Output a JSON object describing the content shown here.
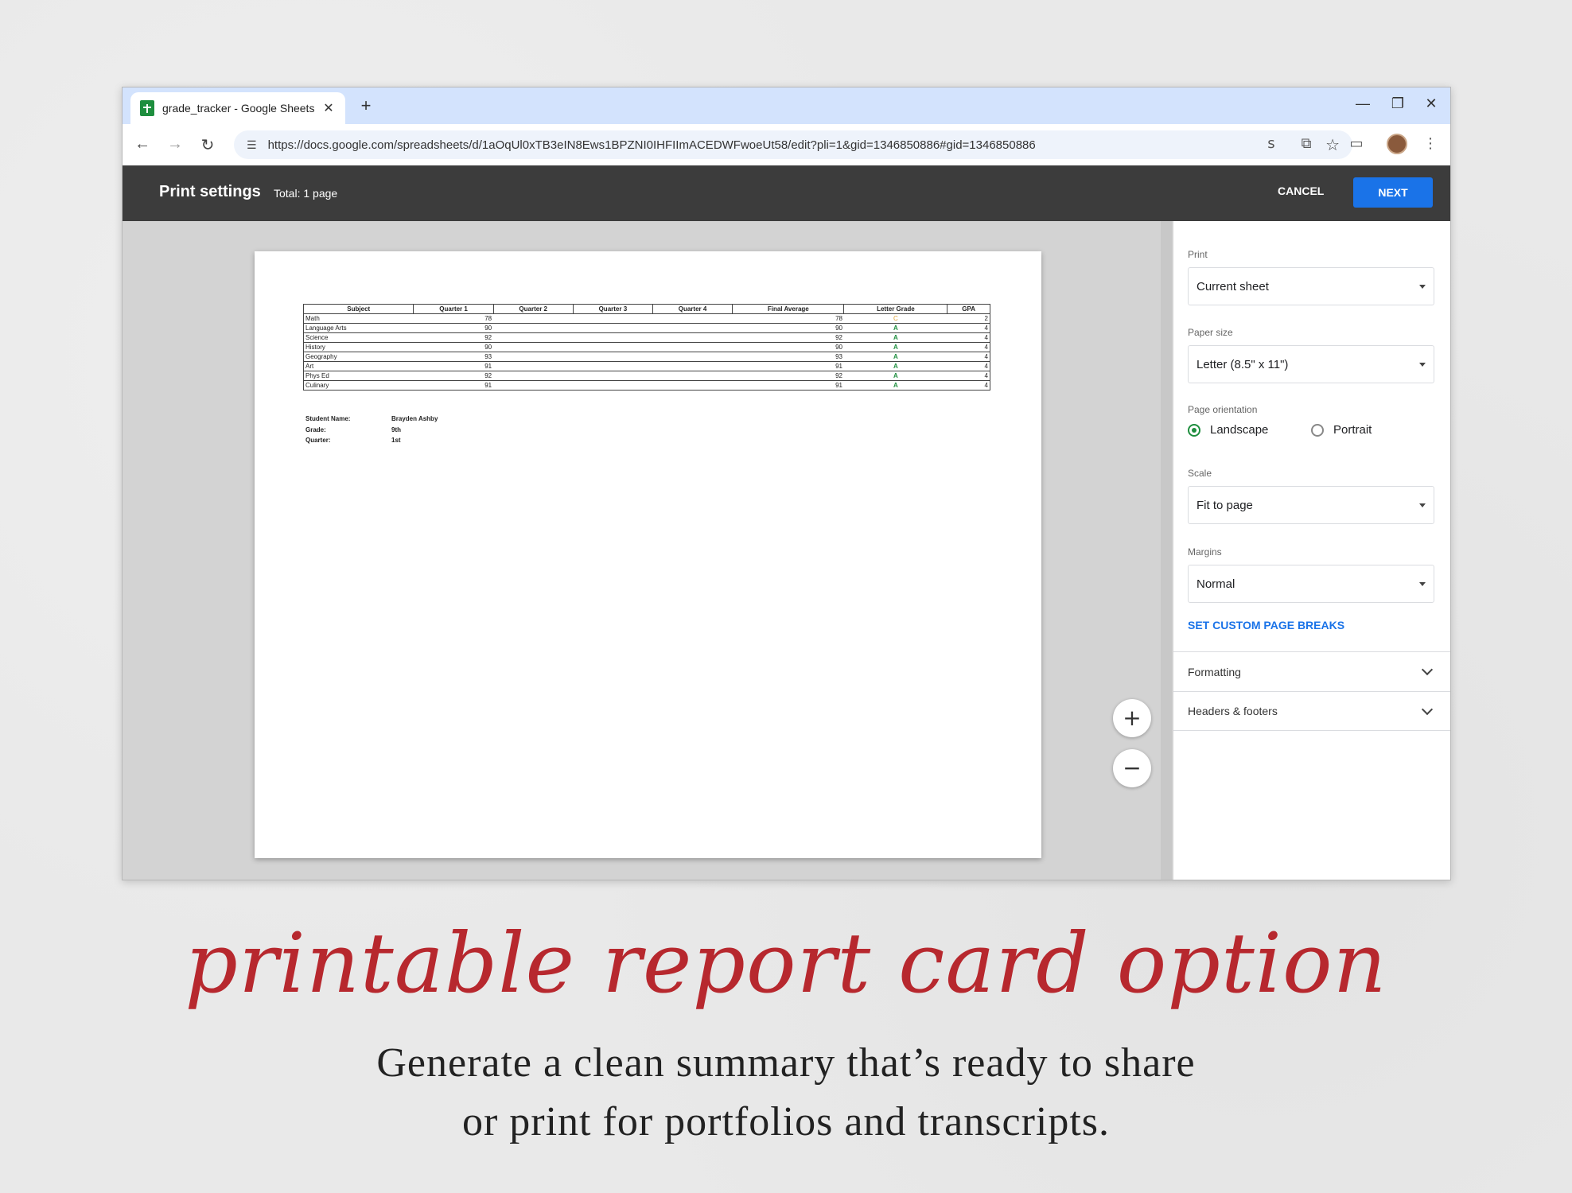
{
  "browser": {
    "tab_title": "grade_tracker - Google Sheets",
    "tab_close": "✕",
    "new_tab": "+",
    "url": "https://docs.google.com/spreadsheets/d/1aOqUl0xTB3eIN8Ews1BPZNI0IHFIImACEDWFwoeUt58/edit?pli=1&gid=1346850886#gid=1346850886",
    "window_controls": [
      "—",
      "❐",
      "✕"
    ],
    "nav": {
      "back": "←",
      "forward": "→",
      "reload": "↻"
    }
  },
  "print_header": {
    "title": "Print settings",
    "total": "Total: 1 page",
    "cancel": "CANCEL",
    "next": "NEXT"
  },
  "report": {
    "columns": [
      "Subject",
      "Quarter 1",
      "Quarter 2",
      "Quarter 3",
      "Quarter 4",
      "Final Average",
      "Letter Grade",
      "GPA"
    ],
    "rows": [
      [
        "Math",
        "78",
        "",
        "",
        "",
        "78",
        "C",
        "2"
      ],
      [
        "Language Arts",
        "90",
        "",
        "",
        "",
        "90",
        "A",
        "4"
      ],
      [
        "Science",
        "92",
        "",
        "",
        "",
        "92",
        "A",
        "4"
      ],
      [
        "History",
        "90",
        "",
        "",
        "",
        "90",
        "A",
        "4"
      ],
      [
        "Geography",
        "93",
        "",
        "",
        "",
        "93",
        "A",
        "4"
      ],
      [
        "Art",
        "91",
        "",
        "",
        "",
        "91",
        "A",
        "4"
      ],
      [
        "Phys Ed",
        "92",
        "",
        "",
        "",
        "92",
        "A",
        "4"
      ],
      [
        "Culinary",
        "91",
        "",
        "",
        "",
        "91",
        "A",
        "4"
      ]
    ],
    "info": [
      {
        "label": "Student Name:",
        "value": "Brayden Ashby"
      },
      {
        "label": "Grade:",
        "value": "9th"
      },
      {
        "label": "Quarter:",
        "value": "1st"
      }
    ]
  },
  "zoom": {
    "in": "+",
    "out": "−"
  },
  "settings": {
    "print_label": "Print",
    "print_value": "Current sheet",
    "paper_label": "Paper size",
    "paper_value": "Letter (8.5\" x 11\")",
    "orientation_label": "Page orientation",
    "landscape": "Landscape",
    "portrait": "Portrait",
    "orientation_selected": "Landscape",
    "scale_label": "Scale",
    "scale_value": "Fit to page",
    "margins_label": "Margins",
    "margins_value": "Normal",
    "page_breaks": "SET CUSTOM PAGE BREAKS",
    "formatting": "Formatting",
    "headers_footers": "Headers & footers"
  },
  "caption": {
    "title": "printable report card option",
    "line1": "Generate a clean summary that’s ready to share",
    "line2": "or print for portfolios and transcripts."
  },
  "colors": {
    "accent": "#1a73e8",
    "radio_green": "#1e8e3e",
    "caption_red": "#b7282e",
    "header_dark": "#3c3c3c"
  }
}
